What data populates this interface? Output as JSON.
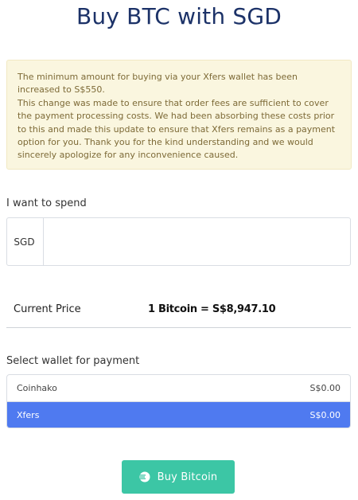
{
  "page": {
    "title": "Buy BTC with SGD"
  },
  "notice": {
    "line1": "The minimum amount for buying via your Xfers wallet has been increased to S$550.",
    "line2": "This change was made to ensure that order fees are sufficient to cover the payment processing costs. We had been absorbing these costs prior to this and made this update to ensure that Xfers remains as a payment option for you. Thank you for the kind understanding and we would sincerely apologize for any inconvenience caused."
  },
  "spend": {
    "label": "I want to spend",
    "currency": "SGD",
    "value": "",
    "placeholder": ""
  },
  "price": {
    "label": "Current Price",
    "value": "1 Bitcoin = S$8,947.10"
  },
  "wallets": {
    "label": "Select wallet for payment",
    "items": [
      {
        "name": "Coinhako",
        "balance": "S$0.00",
        "selected": false
      },
      {
        "name": "Xfers",
        "balance": "S$0.00",
        "selected": true
      }
    ]
  },
  "buy_button": {
    "label": "Buy Bitcoin",
    "icon": "coin-stack-icon"
  },
  "colors": {
    "title": "#1c3268",
    "notice_bg": "#faf6df",
    "notice_text": "#7d6a37",
    "selected_wallet": "#4f7af0",
    "buy_button": "#3cc6a5"
  }
}
